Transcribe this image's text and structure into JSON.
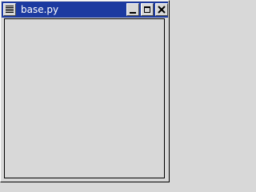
{
  "window": {
    "title": "base.py",
    "titlebar_color": "#1c3aa0",
    "controls": {
      "menu_icon": "window-menu-icon",
      "minimize_icon": "minimize-icon",
      "maximize_icon": "maximize-icon",
      "close_icon": "close-icon"
    }
  }
}
